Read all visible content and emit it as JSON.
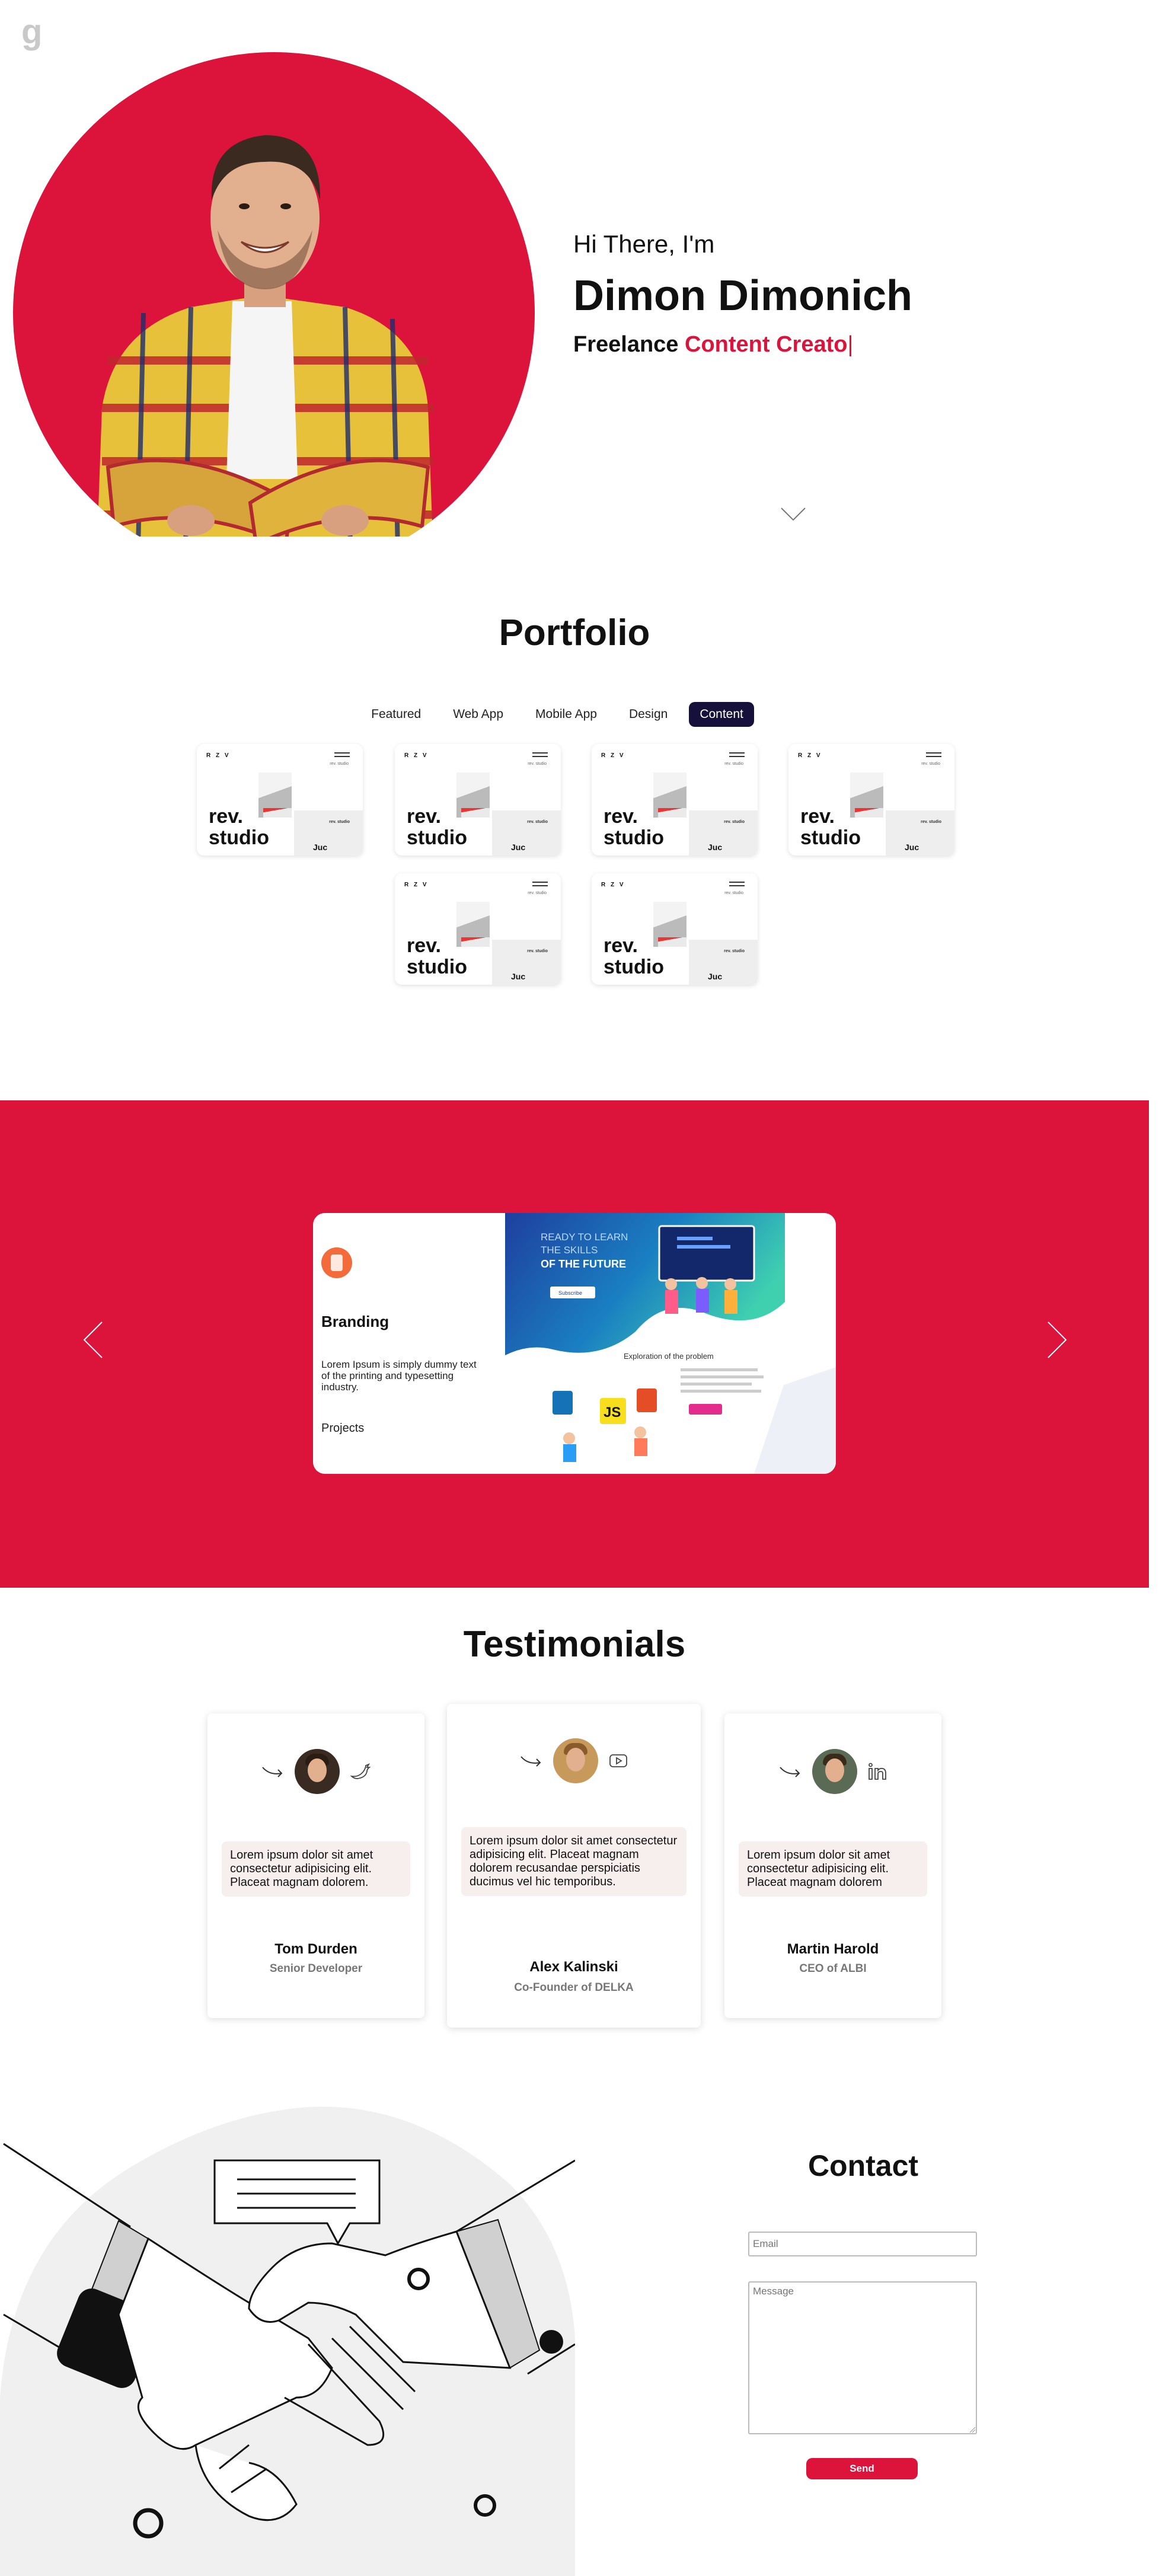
{
  "brand": {
    "logo_letter": "g"
  },
  "hero": {
    "greeting": "Hi There, I'm",
    "name": "Dimon Dimonich",
    "role_prefix": "Freelance",
    "role_typed": "Content Creato",
    "caret": "|",
    "accent_color": "#dc143c"
  },
  "portfolio": {
    "title": "Portfolio",
    "tabs": [
      {
        "label": "Featured",
        "active": false
      },
      {
        "label": "Web App",
        "active": false
      },
      {
        "label": "Mobile App",
        "active": false
      },
      {
        "label": "Design",
        "active": false
      },
      {
        "label": "Content",
        "active": true
      }
    ],
    "card": {
      "nav": "R Z V",
      "tag": "rev. studio",
      "title_line1": "rev.",
      "title_line2": "studio",
      "foot": "Juc"
    }
  },
  "showcase": {
    "title": "Branding",
    "description": "Lorem Ipsum is simply dummy text of the printing and typesetting industry.",
    "link": "Projects",
    "art": {
      "headline1": "READY TO LEARN",
      "headline2": "THE SKILLS",
      "headline3": "OF THE FUTURE",
      "button": "Subscribe",
      "section": "Exploration of the problem",
      "js": "JS"
    },
    "prev_icon": "chevron-left-icon",
    "next_icon": "chevron-right-icon"
  },
  "testimonials": {
    "title": "Testimonials",
    "items": [
      {
        "quote": "Lorem ipsum dolor sit amet consectetur adipisicing elit. Placeat magnam dolorem.",
        "name": "Tom Durden",
        "role": "Senior Developer",
        "social": "twitter-icon"
      },
      {
        "quote": "Lorem ipsum dolor sit amet consectetur adipisicing elit. Placeat magnam dolorem recusandae perspiciatis ducimus vel hic temporibus.",
        "name": "Alex Kalinski",
        "role": "Co-Founder of DELKA",
        "social": "youtube-icon"
      },
      {
        "quote": "Lorem ipsum dolor sit amet consectetur adipisicing elit. Placeat magnam dolorem",
        "name": "Martin Harold",
        "role": "CEO of ALBI",
        "social": "linkedin-icon"
      }
    ]
  },
  "contact": {
    "title": "Contact",
    "email_placeholder": "Email",
    "message_placeholder": "Message",
    "send_label": "Send"
  }
}
